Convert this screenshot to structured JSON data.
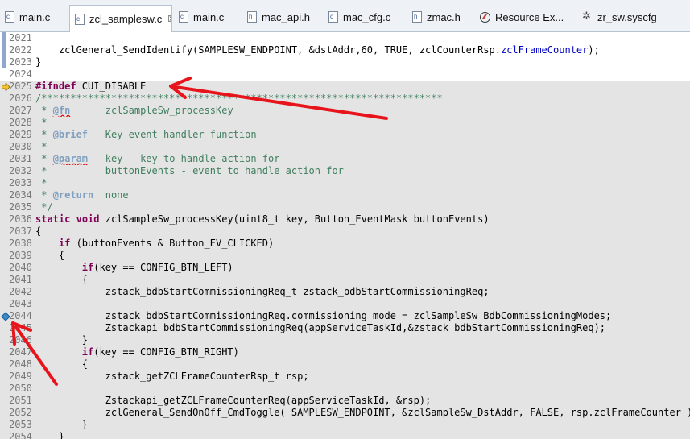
{
  "tabs": [
    {
      "label": "main.c",
      "icon": "c-file-icon"
    },
    {
      "label": "zcl_samplesw.c",
      "icon": "c-file-icon",
      "active": true,
      "close": "☒"
    },
    {
      "label": "main.c",
      "icon": "c-file-icon"
    },
    {
      "label": "mac_api.h",
      "icon": "h-file-icon"
    },
    {
      "label": "mac_cfg.c",
      "icon": "c-file-icon"
    },
    {
      "label": "zmac.h",
      "icon": "h-file-icon"
    },
    {
      "label": "Resource Ex...",
      "icon": "resource-explorer-icon"
    },
    {
      "label": "zr_sw.syscfg",
      "icon": "syscfg-icon"
    }
  ],
  "lines": [
    {
      "n": "2021",
      "code": ""
    },
    {
      "n": "2022",
      "code": "    zclGeneral_SendIdentify(SAMPLESW_ENDPOINT, &dstAddr,60, TRUE, zclCounterRsp.zclFrameCounter);"
    },
    {
      "n": "2023",
      "code": "}"
    },
    {
      "n": "2024",
      "code": ""
    },
    {
      "n": "2025",
      "code": "#ifndef CUI_DISABLE"
    },
    {
      "n": "2026",
      "code": "/*********************************************************************"
    },
    {
      "n": "2027",
      "code": " * @fn      zclSampleSw_processKey"
    },
    {
      "n": "2028",
      "code": " *"
    },
    {
      "n": "2029",
      "code": " * @brief   Key event handler function"
    },
    {
      "n": "2030",
      "code": " *"
    },
    {
      "n": "2031",
      "code": " * @param   key - key to handle action for"
    },
    {
      "n": "2032",
      "code": " *          buttonEvents - event to handle action for"
    },
    {
      "n": "2033",
      "code": " *"
    },
    {
      "n": "2034",
      "code": " * @return  none"
    },
    {
      "n": "2035",
      "code": " */"
    },
    {
      "n": "2036",
      "code": "static void zclSampleSw_processKey(uint8_t key, Button_EventMask buttonEvents)"
    },
    {
      "n": "2037",
      "code": "{"
    },
    {
      "n": "2038",
      "code": "    if (buttonEvents & Button_EV_CLICKED)"
    },
    {
      "n": "2039",
      "code": "    {"
    },
    {
      "n": "2040",
      "code": "        if(key == CONFIG_BTN_LEFT)"
    },
    {
      "n": "2041",
      "code": "        {"
    },
    {
      "n": "2042",
      "code": "            zstack_bdbStartCommissioningReq_t zstack_bdbStartCommissioningReq;"
    },
    {
      "n": "2043",
      "code": ""
    },
    {
      "n": "2044",
      "code": "            zstack_bdbStartCommissioningReq.commissioning_mode = zclSampleSw_BdbCommissioningModes;"
    },
    {
      "n": "2045",
      "code": "            Zstackapi_bdbStartCommissioningReq(appServiceTaskId,&zstack_bdbStartCommissioningReq);"
    },
    {
      "n": "2046",
      "code": "        }"
    },
    {
      "n": "2047",
      "code": "        if(key == CONFIG_BTN_RIGHT)"
    },
    {
      "n": "2048",
      "code": "        {"
    },
    {
      "n": "2049",
      "code": "            zstack_getZCLFrameCounterRsp_t rsp;"
    },
    {
      "n": "2050",
      "code": ""
    },
    {
      "n": "2051",
      "code": "            Zstackapi_getZCLFrameCounterReq(appServiceTaskId, &rsp);"
    },
    {
      "n": "2052",
      "code": "            zclGeneral_SendOnOff_CmdToggle( SAMPLESW_ENDPOINT, &zclSampleSw_DstAddr, FALSE, rsp.zclFrameCounter );"
    },
    {
      "n": "2053",
      "code": "        }"
    },
    {
      "n": "2054",
      "code": "    }"
    }
  ],
  "annotation_color": "#e8141c"
}
